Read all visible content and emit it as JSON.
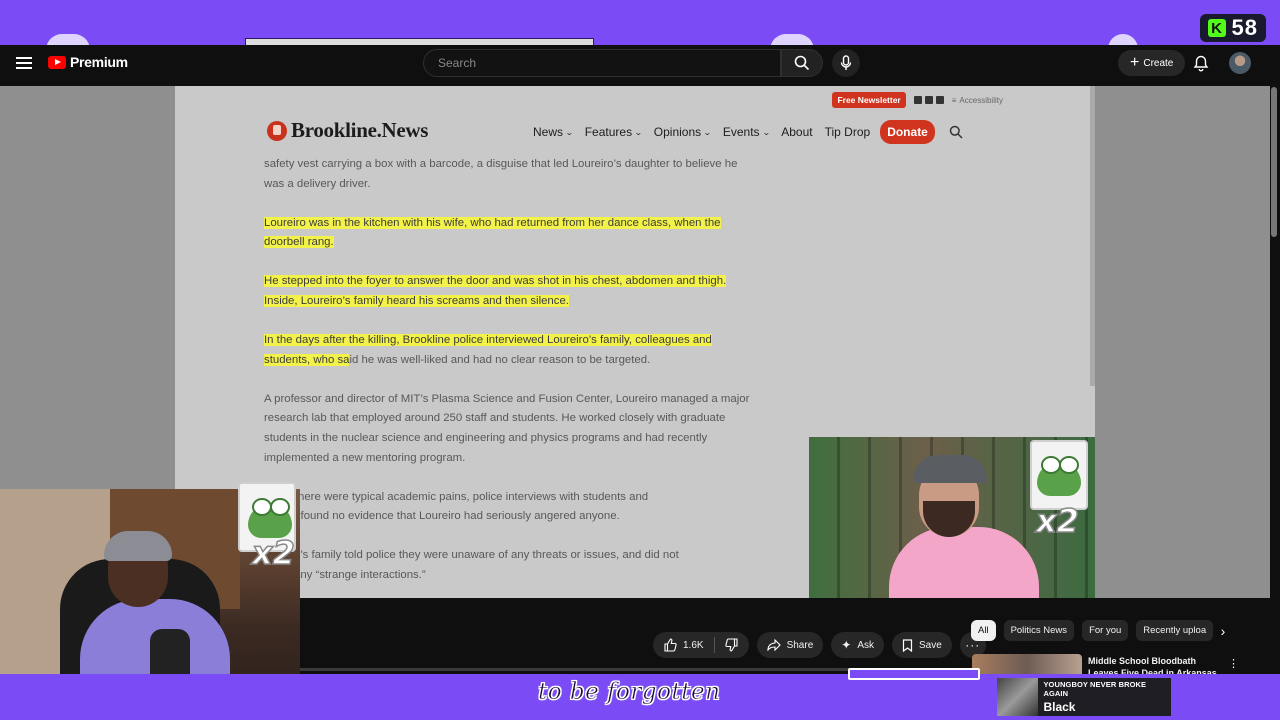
{
  "stream": {
    "kick_viewers": "58",
    "caption": "to be forgotten",
    "now_playing": {
      "song": "YOUNGBOY NEVER BROKE AGAIN",
      "artist": "Black"
    }
  },
  "youtube": {
    "logo_label": "Premium",
    "search_placeholder": "Search",
    "create_label": "Create",
    "actions": {
      "likes": "1.6K",
      "share": "Share",
      "ask": "Ask",
      "save": "Save"
    },
    "chips": [
      "All",
      "Politics News",
      "For you",
      "Recently uploa"
    ],
    "recommended": {
      "title": "Middle School Bloodbath Leaves Five Dead in Arkansas"
    }
  },
  "article": {
    "newsletter": "Free Newsletter",
    "accessibility": "Accessibility",
    "site_name": "Brookline.News",
    "nav": {
      "news": "News",
      "features": "Features",
      "opinions": "Opinions",
      "events": "Events",
      "about": "About",
      "tip_drop": "Tip Drop",
      "donate": "Donate"
    },
    "paragraphs": {
      "p0": "safety vest carrying a box with a barcode, a disguise that led Loureiro’s daughter to believe he was a delivery driver.",
      "p1": "Loureiro was in the kitchen with his wife, who had returned from her dance class, when the doorbell rang.",
      "p2": "He stepped into the foyer to answer the door and was shot in his chest, abdomen and thigh. Inside, Loureiro’s family heard his screams and then silence.",
      "p3_highlight": "In the days after the killing, Brookline police interviewed Loureiro’s family, colleagues and students, who sa",
      "p3_rest": "id he was well-liked and had no clear reason to be targeted.",
      "p4": "A professor and director of MIT’s Plasma Science and Fusion Center, Loureiro managed a major research lab that employed around 250 staff and students. He worked closely with graduate students in the nuclear science and engineering and physics programs and had recently implemented a new mentoring program.",
      "p5a": "gh there were typical academic pains, police interviews with students and",
      "p5b": "ues found no evidence that Loureiro had seriously angered anyone.",
      "p6a": "o’s family told police they were unaware of any threats or issues, and did not",
      "p6b": "any “strange interactions.”"
    }
  },
  "stickers": {
    "multiplier": "x2"
  }
}
